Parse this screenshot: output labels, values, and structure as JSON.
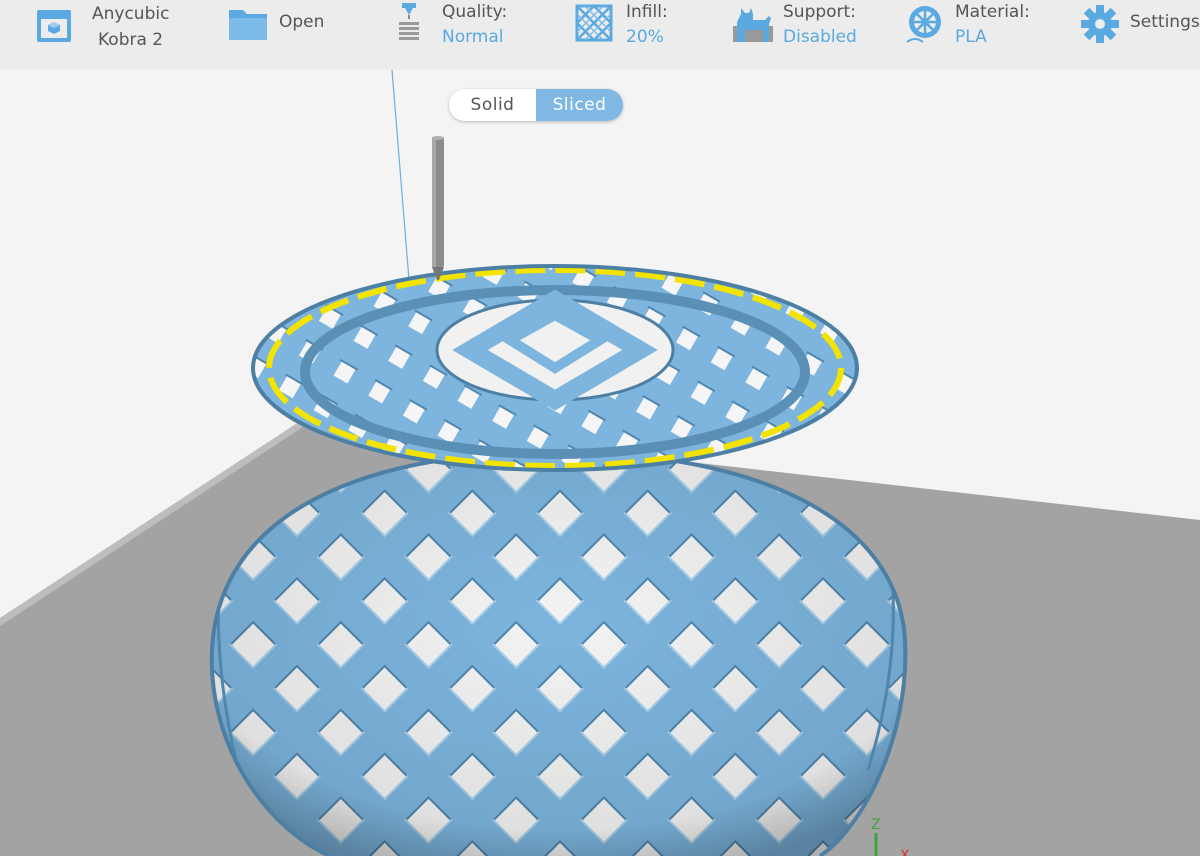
{
  "toolbar": {
    "printer": {
      "line1": "Anycubic",
      "line2": "Kobra 2",
      "icon": "printer-icon"
    },
    "open": {
      "label": "Open",
      "icon": "folder-icon"
    },
    "quality": {
      "label": "Quality:",
      "value": "Normal",
      "icon": "nozzle-layers-icon"
    },
    "infill": {
      "label": "Infill:",
      "value": "20%",
      "icon": "infill-grid-icon"
    },
    "support": {
      "label": "Support:",
      "value": "Disabled",
      "icon": "support-dog-icon"
    },
    "material": {
      "label": "Material:",
      "value": "PLA",
      "icon": "filament-spool-icon"
    },
    "settings": {
      "label": "Settings",
      "icon": "gear-icon"
    }
  },
  "view_toggle": {
    "solid_label": "Solid",
    "sliced_label": "Sliced",
    "active": "Sliced"
  },
  "axes": {
    "z_label": "Z",
    "x_label": "X"
  },
  "colors": {
    "accent": "#5aa9e0",
    "model_fill": "#7db5de",
    "top_layer_highlight": "#f2e400",
    "build_plate": "#9a9a9a",
    "z_axis": "#3da33d",
    "x_axis": "#d93030"
  }
}
